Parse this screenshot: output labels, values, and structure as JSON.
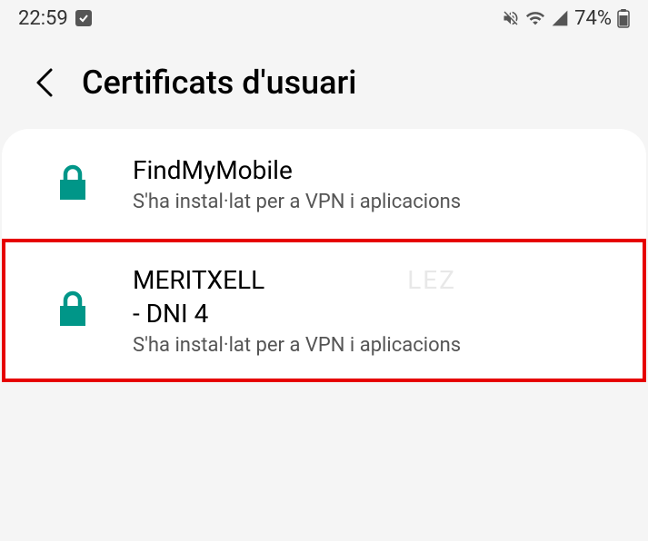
{
  "status_bar": {
    "time": "22:59",
    "battery_percent": "74%"
  },
  "header": {
    "title": "Certificats d'usuari"
  },
  "certificates": [
    {
      "name": "FindMyMobile",
      "description": "S'ha instal·lat per a VPN i aplicacions",
      "highlighted": false
    },
    {
      "name_line1": "MERITXELL",
      "name_line1_redacted": "LEZ",
      "name_line2": "- DNI 4",
      "description": "S'ha instal·lat per a VPN i aplicacions",
      "highlighted": true
    }
  ]
}
